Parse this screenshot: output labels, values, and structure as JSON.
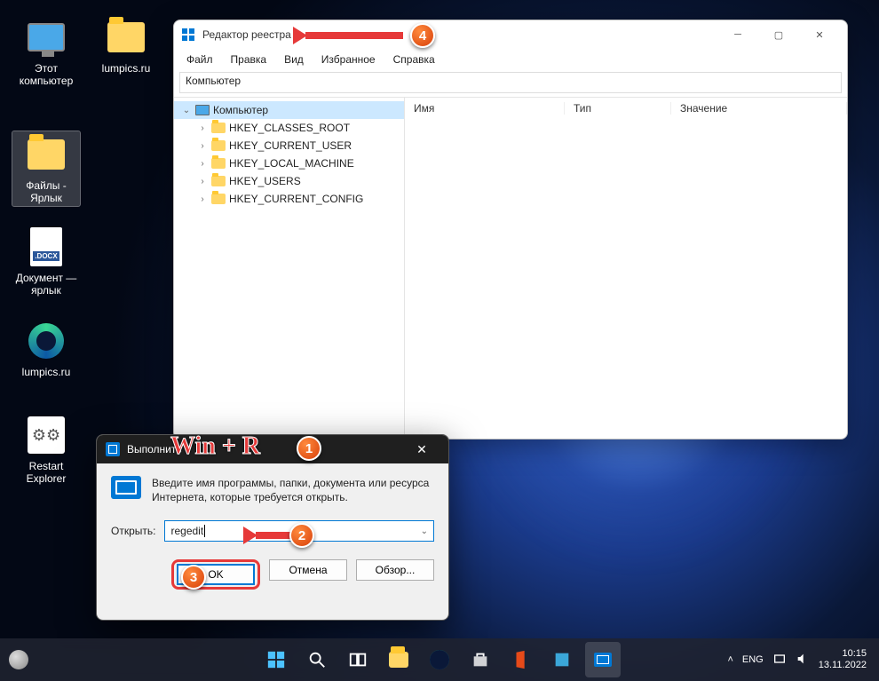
{
  "desktop_icons": [
    {
      "label": "Этот компьютер",
      "kind": "pc"
    },
    {
      "label": "lumpics.ru",
      "kind": "folder"
    },
    {
      "label": "Файлы - Ярлык",
      "kind": "folder",
      "selected": true
    },
    {
      "label": "Документ — ярлык",
      "kind": "docx",
      "badge": ".DOCX"
    },
    {
      "label": "lumpics.ru",
      "kind": "edge"
    },
    {
      "label": "Restart Explorer",
      "kind": "bat",
      "glyph": "⚙⚙"
    }
  ],
  "regedit": {
    "title": "Редактор реестра",
    "menu": [
      "Файл",
      "Правка",
      "Вид",
      "Избранное",
      "Справка"
    ],
    "address": "Компьютер",
    "root": "Компьютер",
    "keys": [
      "HKEY_CLASSES_ROOT",
      "HKEY_CURRENT_USER",
      "HKEY_LOCAL_MACHINE",
      "HKEY_USERS",
      "HKEY_CURRENT_CONFIG"
    ],
    "columns": [
      "Имя",
      "Тип",
      "Значение"
    ]
  },
  "run": {
    "title": "Выполнить",
    "description": "Введите имя программы, папки, документа или ресурса Интернета, которые требуется открыть.",
    "open_label": "Открыть:",
    "value": "regedit",
    "buttons": {
      "ok": "OK",
      "cancel": "Отмена",
      "browse": "Обзор..."
    }
  },
  "annotations": {
    "shortcut": "Win + R",
    "b1": "1",
    "b2": "2",
    "b3": "3",
    "b4": "4"
  },
  "taskbar": {
    "lang": "ENG",
    "time": "10:15",
    "date": "13.11.2022",
    "tray_chevron": "˄"
  }
}
